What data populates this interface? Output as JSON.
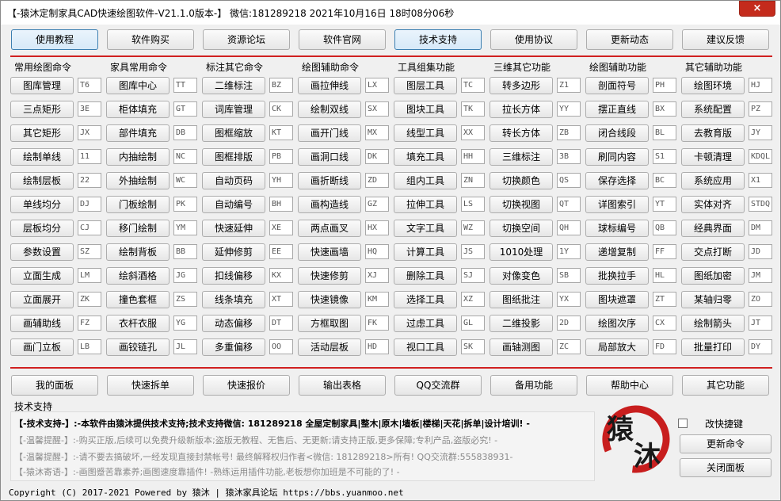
{
  "window": {
    "title": "【-猿沐定制家具CAD快速绘图软件-V21.1.0版本-】 微信:181289218 2021年10月16日 18时08分06秒",
    "close_glyph": "×"
  },
  "top_buttons": [
    "使用教程",
    "软件购买",
    "资源论坛",
    "软件官网",
    "技术支持",
    "使用协议",
    "更新动态",
    "建议反馈"
  ],
  "columns": [
    {
      "header": "常用绘图命令",
      "items": [
        [
          "图库管理",
          "T6"
        ],
        [
          "三点矩形",
          "3E"
        ],
        [
          "其它矩形",
          "JX"
        ],
        [
          "绘制单线",
          "11"
        ],
        [
          "绘制层板",
          "22"
        ],
        [
          "单线均分",
          "DJ"
        ],
        [
          "层板均分",
          "CJ"
        ],
        [
          "参数设置",
          "SZ"
        ],
        [
          "立面生成",
          "LM"
        ],
        [
          "立面展开",
          "ZK"
        ],
        [
          "画辅助线",
          "FZ"
        ],
        [
          "画门立板",
          "LB"
        ]
      ]
    },
    {
      "header": "家具常用命令",
      "items": [
        [
          "图库中心",
          "TT"
        ],
        [
          "柜体填充",
          "GT"
        ],
        [
          "部件填充",
          "DB"
        ],
        [
          "内抽绘制",
          "NC"
        ],
        [
          "外抽绘制",
          "WC"
        ],
        [
          "门板绘制",
          "PK"
        ],
        [
          "移门绘制",
          "YM"
        ],
        [
          "绘制背板",
          "BB"
        ],
        [
          "绘斜酒格",
          "JG"
        ],
        [
          "撞色套框",
          "ZS"
        ],
        [
          "衣杆衣服",
          "YG"
        ],
        [
          "画铰链孔",
          "JL"
        ]
      ]
    },
    {
      "header": "标注其它命令",
      "items": [
        [
          "二维标注",
          "BZ"
        ],
        [
          "词库管理",
          "CK"
        ],
        [
          "图框缩放",
          "KT"
        ],
        [
          "图框排版",
          "PB"
        ],
        [
          "自动页码",
          "YH"
        ],
        [
          "自动编号",
          "BH"
        ],
        [
          "快速延伸",
          "XE"
        ],
        [
          "延伸修剪",
          "EE"
        ],
        [
          "扣线偏移",
          "KX"
        ],
        [
          "线条填充",
          "XT"
        ],
        [
          "动态偏移",
          "DT"
        ],
        [
          "多重偏移",
          "OO"
        ]
      ]
    },
    {
      "header": "绘图辅助命令",
      "items": [
        [
          "画拉伸线",
          "LX"
        ],
        [
          "绘制双线",
          "SX"
        ],
        [
          "画开门线",
          "MX"
        ],
        [
          "画洞口线",
          "DK"
        ],
        [
          "画折断线",
          "ZD"
        ],
        [
          "画构造线",
          "GZ"
        ],
        [
          "两点画叉",
          "HX"
        ],
        [
          "快速画墙",
          "HQ"
        ],
        [
          "快速修剪",
          "XJ"
        ],
        [
          "快速镜像",
          "KM"
        ],
        [
          "方框取图",
          "FK"
        ],
        [
          "活动层板",
          "HD"
        ]
      ]
    },
    {
      "header": "工具组集功能",
      "items": [
        [
          "图层工具",
          "TC"
        ],
        [
          "图块工具",
          "TK"
        ],
        [
          "线型工具",
          "XX"
        ],
        [
          "填充工具",
          "HH"
        ],
        [
          "组内工具",
          "ZN"
        ],
        [
          "拉伸工具",
          "LS"
        ],
        [
          "文字工具",
          "WZ"
        ],
        [
          "计算工具",
          "JS"
        ],
        [
          "删除工具",
          "SJ"
        ],
        [
          "选择工具",
          "XZ"
        ],
        [
          "过虑工具",
          "GL"
        ],
        [
          "视口工具",
          "SK"
        ]
      ]
    },
    {
      "header": "三维其它功能",
      "items": [
        [
          "转多边形",
          "Z1"
        ],
        [
          "拉长方体",
          "YY"
        ],
        [
          "转长方体",
          "ZB"
        ],
        [
          "三维标注",
          "3B"
        ],
        [
          "切换颜色",
          "QS"
        ],
        [
          "切换视图",
          "QT"
        ],
        [
          "切换空间",
          "QH"
        ],
        [
          "1010处理",
          "1Y"
        ],
        [
          "对像变色",
          "SB"
        ],
        [
          "图纸批注",
          "YX"
        ],
        [
          "二维投影",
          "2D"
        ],
        [
          "画轴测图",
          "ZC"
        ]
      ]
    },
    {
      "header": "绘图辅助功能",
      "items": [
        [
          "剖面符号",
          "PH"
        ],
        [
          "摆正直线",
          "BX"
        ],
        [
          "闭合线段",
          "BL"
        ],
        [
          "刷同内容",
          "S1"
        ],
        [
          "保存选择",
          "BC"
        ],
        [
          "详图索引",
          "YT"
        ],
        [
          "球标编号",
          "QB"
        ],
        [
          "递增复制",
          "FF"
        ],
        [
          "批换拉手",
          "HL"
        ],
        [
          "图块遮罩",
          "ZT"
        ],
        [
          "绘图次序",
          "CX"
        ],
        [
          "局部放大",
          "FD"
        ]
      ]
    },
    {
      "header": "其它辅助功能",
      "items": [
        [
          "绘图环境",
          "HJ"
        ],
        [
          "系统配置",
          "PZ"
        ],
        [
          "去教育版",
          "JY"
        ],
        [
          "卡顿清理",
          "KDQL"
        ],
        [
          "系统应用",
          "X1"
        ],
        [
          "实体对齐",
          "STDQ"
        ],
        [
          "经典界面",
          "DM"
        ],
        [
          "交点打断",
          "JD"
        ],
        [
          "图纸加密",
          "JM"
        ],
        [
          "某轴归零",
          "ZO"
        ],
        [
          "绘制箭头",
          "JT"
        ],
        [
          "批量打印",
          "DY"
        ]
      ]
    }
  ],
  "bottom_buttons": [
    "我的面板",
    "快速拆单",
    "快速报价",
    "输出表格",
    "QQ交流群",
    "备用功能",
    "帮助中心",
    "其它功能"
  ],
  "support": {
    "section_label": "技术支持",
    "lines": [
      "【-技术支持-】:-本软件由猿沐提供技术支持;技术支持微信: 181289218 全屋定制家具|整木|原木|墙板|楼梯|天花|拆单|设计培训! -",
      "【-温馨提醒-】:-购买正版,后续可以免费升级新版本;盗版无教程、无售后、无更新;请支持正版,更多保障;专利产品,盗版必究! -",
      "【-温馨提醒-】:-请不要去搞破坏,一经发现直接封禁帐号! 最终解释权归作者<微信: 181289218>所有! QQ交流群:555838931-",
      "【-猿沐寄语-】:-画图蹙苦靠素养;画图速度靠插件! -熟练运用插件功能,老板想你加班是不可能的了! -"
    ]
  },
  "logo": {
    "text1": "猿",
    "text2": "沐",
    "color": "#c81e1e"
  },
  "right_panel": {
    "checkbox_label": "改快捷键",
    "checked": false,
    "update_button": "更新命令",
    "close_button": "关闭面板"
  },
  "footer": "Copyright (C) 2017-2021 Powered by 猿沐 | 猿沐家具论坛 https://bbs.yuanmoo.net"
}
